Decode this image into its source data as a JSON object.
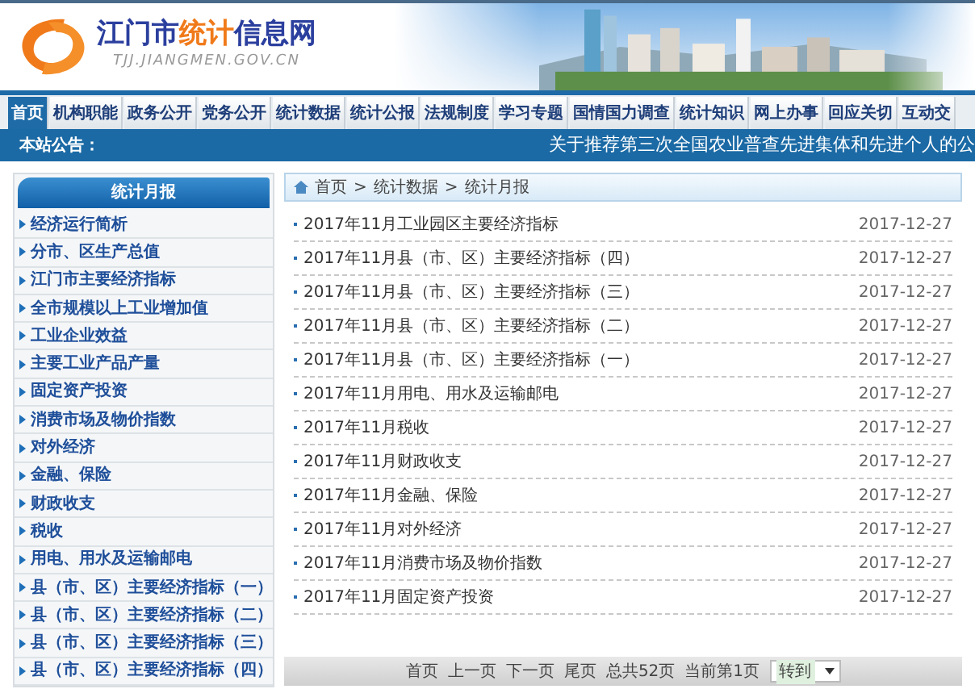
{
  "header": {
    "title_parts": [
      {
        "text": "江门市",
        "color": "#2b3f9e"
      },
      {
        "text": "统计",
        "color": "#f07a1a"
      },
      {
        "text": "信息网",
        "color": "#2b3f9e"
      }
    ],
    "domain": "TJJ.JIANGMEN.GOV.CN"
  },
  "nav": [
    {
      "label": "首页",
      "selected": true
    },
    {
      "label": "机构职能",
      "selected": false
    },
    {
      "label": "政务公开",
      "selected": false
    },
    {
      "label": "党务公开",
      "selected": false
    },
    {
      "label": "统计数据",
      "selected": false
    },
    {
      "label": "统计公报",
      "selected": false
    },
    {
      "label": "法规制度",
      "selected": false
    },
    {
      "label": "学习专题",
      "selected": false
    },
    {
      "label": "国情国力调查",
      "selected": false
    },
    {
      "label": "统计知识",
      "selected": false
    },
    {
      "label": "网上办事",
      "selected": false
    },
    {
      "label": "回应关切",
      "selected": false
    },
    {
      "label": "互动交",
      "selected": false
    }
  ],
  "notice": {
    "label": "本站公告：",
    "text": "关于推荐第三次全国农业普查先进集体和先进个人的公"
  },
  "sidebar": {
    "title": "统计月报",
    "items": [
      "经济运行简析",
      "分市、区生产总值",
      "江门市主要经济指标",
      "全市规模以上工业增加值",
      "工业企业效益",
      "主要工业产品产量",
      "固定资产投资",
      "消费市场及物价指数",
      "对外经济",
      "金融、保险",
      "财政收支",
      "税收",
      "用电、用水及运输邮电",
      "县（市、区）主要经济指标（一）",
      "县（市、区）主要经济指标（二）",
      "县（市、区）主要经济指标（三）",
      "县（市、区）主要经济指标（四）"
    ]
  },
  "breadcrumb": [
    "首页",
    ">",
    "统计数据",
    ">",
    "统计月报"
  ],
  "articles": [
    {
      "title": "2017年11月工业园区主要经济指标",
      "date": "2017-12-27"
    },
    {
      "title": "2017年11月县（市、区）主要经济指标（四）",
      "date": "2017-12-27"
    },
    {
      "title": "2017年11月县（市、区）主要经济指标（三）",
      "date": "2017-12-27"
    },
    {
      "title": "2017年11月县（市、区）主要经济指标（二）",
      "date": "2017-12-27"
    },
    {
      "title": "2017年11月县（市、区）主要经济指标（一）",
      "date": "2017-12-27"
    },
    {
      "title": "2017年11月用电、用水及运输邮电",
      "date": "2017-12-27"
    },
    {
      "title": "2017年11月税收",
      "date": "2017-12-27"
    },
    {
      "title": "2017年11月财政收支",
      "date": "2017-12-27"
    },
    {
      "title": "2017年11月金融、保险",
      "date": "2017-12-27"
    },
    {
      "title": "2017年11月对外经济",
      "date": "2017-12-27"
    },
    {
      "title": "2017年11月消费市场及物价指数",
      "date": "2017-12-27"
    },
    {
      "title": "2017年11月固定资产投资",
      "date": "2017-12-27"
    }
  ],
  "pagination": {
    "links": [
      "首页",
      "上一页",
      "下一页",
      "尾页"
    ],
    "info": [
      "总共52页",
      "当前第1页"
    ],
    "jump": "转到"
  }
}
